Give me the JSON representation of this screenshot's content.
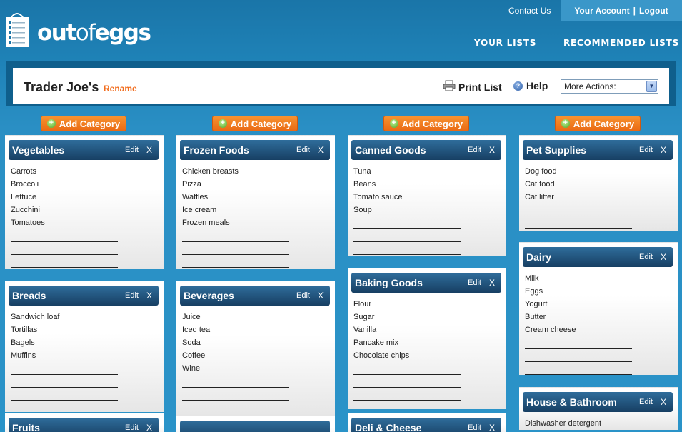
{
  "header": {
    "logo_out": "out",
    "logo_of": "of",
    "logo_eggs": "eggs",
    "contact": "Contact Us",
    "account": "Your Account",
    "separator": "|",
    "logout": "Logout",
    "nav_lists": "YOUR LISTS",
    "nav_recommended": "RECOMMENDED LISTS"
  },
  "list": {
    "name": "Trader Joe's",
    "rename": "Rename",
    "print": "Print List",
    "help": "Help",
    "help_glyph": "?",
    "more_actions": "More Actions:"
  },
  "add_category": "Add Category",
  "edit_label": "Edit",
  "close_label": "X",
  "columns": [
    {
      "cards": [
        {
          "title": "Vegetables",
          "items": [
            "Carrots",
            "Broccoli",
            "Lettuce",
            "Zucchini",
            "Tomatoes"
          ],
          "blanks": 3
        },
        {
          "title": "Breads",
          "items": [
            "Sandwich loaf",
            "Tortillas",
            "Bagels",
            "Muffins"
          ],
          "blanks": 3
        },
        {
          "title": "Fruits",
          "items": [],
          "blanks": 0
        }
      ]
    },
    {
      "cards": [
        {
          "title": "Frozen Foods",
          "items": [
            "Chicken breasts",
            "Pizza",
            "Waffles",
            "Ice cream",
            "Frozen meals"
          ],
          "blanks": 3
        },
        {
          "title": "Beverages",
          "items": [
            "Juice",
            "Iced tea",
            "Soda",
            "Coffee",
            "Wine"
          ],
          "blanks": 3
        },
        {
          "title": "",
          "items": [],
          "blanks": 0
        }
      ]
    },
    {
      "cards": [
        {
          "title": "Canned Goods",
          "items": [
            "Tuna",
            "Beans",
            "Tomato sauce",
            "Soup"
          ],
          "blanks": 3
        },
        {
          "title": "Baking Goods",
          "items": [
            "Flour",
            "Sugar",
            "Vanilla",
            "Pancake mix",
            "Chocolate chips"
          ],
          "blanks": 3
        },
        {
          "title": "Deli & Cheese",
          "items": [],
          "blanks": 0
        }
      ]
    },
    {
      "cards": [
        {
          "title": "Pet Supplies",
          "items": [
            "Dog food",
            "Cat food",
            "Cat litter"
          ],
          "blanks": 2
        },
        {
          "title": "Dairy",
          "items": [
            "Milk",
            "Eggs",
            "Yogurt",
            "Butter",
            "Cream cheese"
          ],
          "blanks": 3
        },
        {
          "title": "House & Bathroom",
          "items": [
            "Dishwasher detergent"
          ],
          "blanks": 0
        }
      ]
    }
  ]
}
